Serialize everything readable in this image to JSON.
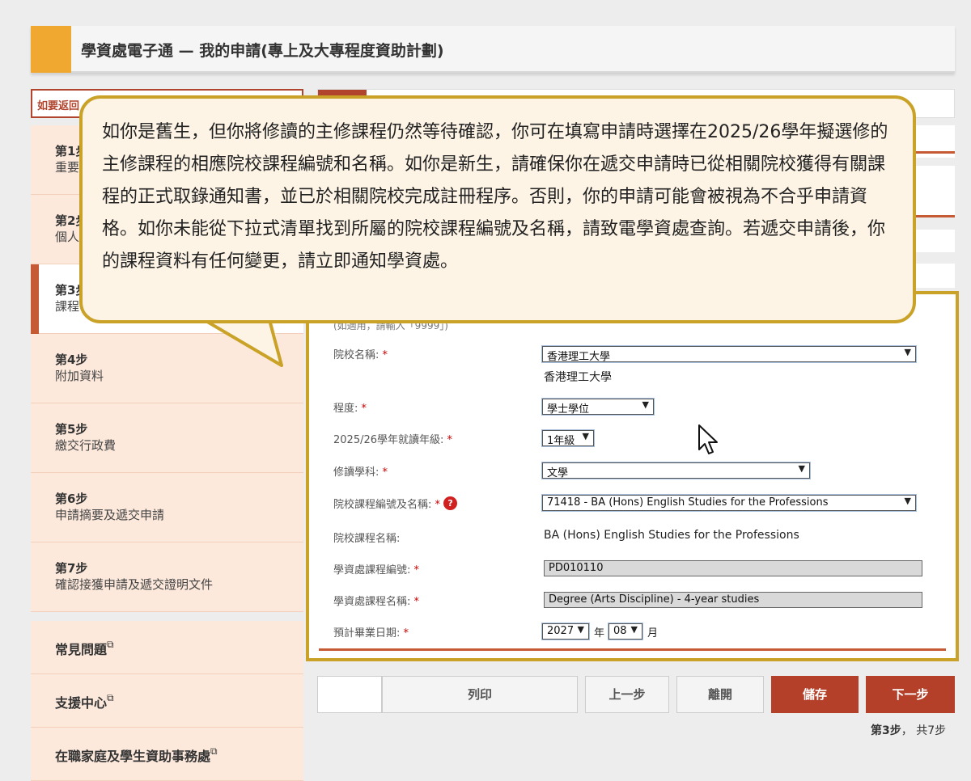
{
  "header": {
    "title": "學資處電子通 — 我的申請(專上及大專程度資助計劃)"
  },
  "back_link": {
    "label": "如要返回"
  },
  "sidebar": {
    "steps": [
      {
        "num": "第1步",
        "label": "重要"
      },
      {
        "num": "第2步",
        "label": "個人"
      },
      {
        "num": "第3步",
        "label": "課程"
      },
      {
        "num": "第4步",
        "label": "附加資料"
      },
      {
        "num": "第5步",
        "label": "繳交行政費"
      },
      {
        "num": "第6步",
        "label": "申請摘要及遞交申請"
      },
      {
        "num": "第7步",
        "label": "確認接獲申請及遞交證明文件"
      }
    ],
    "links": [
      {
        "label": "常見問題"
      },
      {
        "label": "支援中心"
      },
      {
        "label": "在職家庭及學生資助事務處"
      }
    ]
  },
  "callout": {
    "text": "如你是舊生，但你將修讀的主修課程仍然等待確認，你可在填寫申請時選擇在2025/26學年擬選修的主修課程的相應院校課程編號和名稱。如你是新生，請確保你在遞交申請時已從相關院校獲得有關課程的正式取錄通知書，並已於相關院校完成註冊程序。否則，你的申請可能會被視為不合乎申請資格。如你未能從下拉式清單找到所屬的院校課程編號及名稱，請致電學資處查詢。若遞交申請後，你的課程資料有任何變更，請立即通知學資處。"
  },
  "form": {
    "hidden_label": "(如適用，請輸入「9999」)",
    "institution": {
      "label": "院校名稱:",
      "value": "香港理工大學",
      "display": "香港理工大學"
    },
    "level": {
      "label": "程度:",
      "value": "學士學位"
    },
    "year_of_study": {
      "label": "2025/26學年就讀年級:",
      "value": "1年級"
    },
    "discipline": {
      "label": "修讀學科:",
      "value": "文學"
    },
    "programme_code": {
      "label": "院校課程編號及名稱:",
      "value": "71418 - BA (Hons) English Studies for the Professions"
    },
    "programme_name": {
      "label": "院校課程名稱:",
      "value": "BA (Hons) English Studies for the Professions"
    },
    "sfo_code": {
      "label": "學資處課程編號:",
      "value": "PD010110"
    },
    "sfo_name": {
      "label": "學資處課程名稱:",
      "value": "Degree (Arts Discipline) - 4-year studies"
    },
    "graduation": {
      "label": "預計畢業日期:",
      "year": "2027",
      "year_unit": "年",
      "month": "08",
      "month_unit": "月"
    },
    "required_mark": "*",
    "help_mark": "?"
  },
  "buttons": {
    "print": "列印",
    "prev": "上一步",
    "leave": "離開",
    "save": "儲存",
    "next": "下一步"
  },
  "step_info": {
    "current": "第3步",
    "sep": "，",
    "total": "共7步"
  },
  "colors": {
    "accent": "#f0a830",
    "brand_red": "#b5402a",
    "callout_border": "#c9a227",
    "sidebar_bg": "#fde9dc"
  }
}
